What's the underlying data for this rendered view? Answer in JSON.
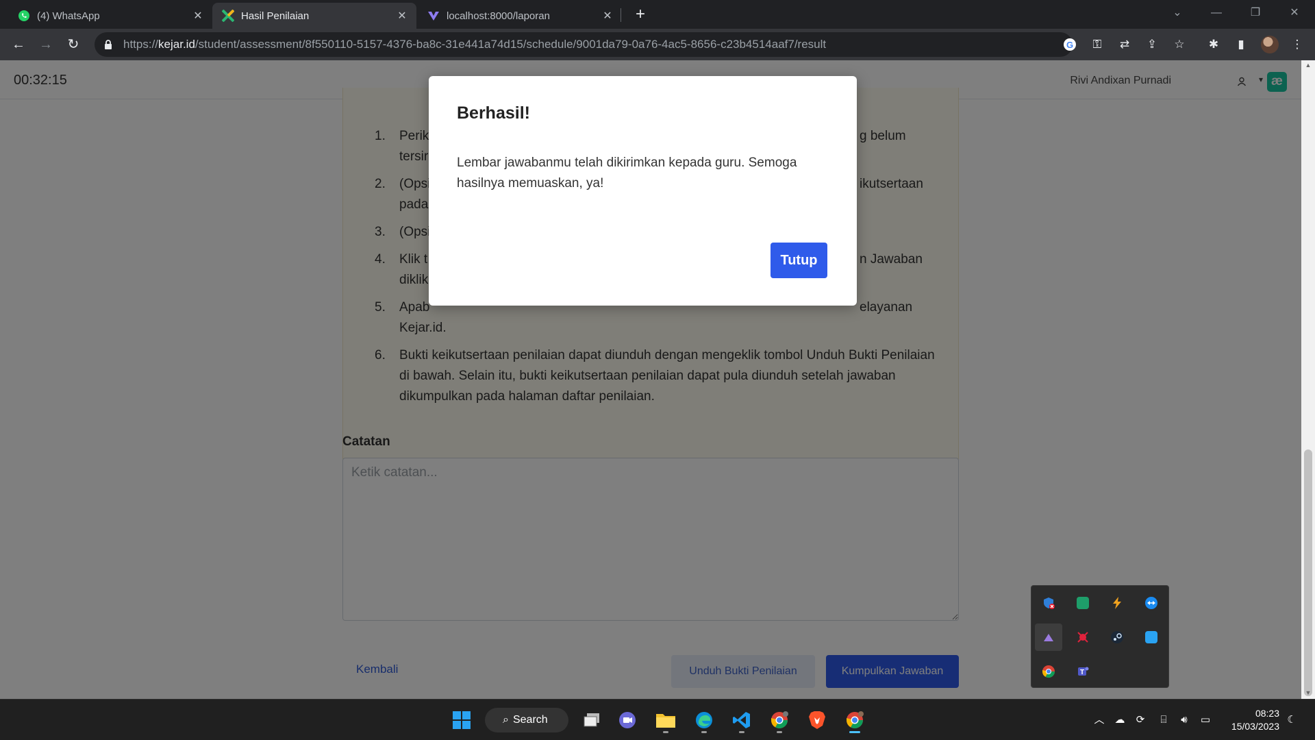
{
  "browser": {
    "tabs": [
      {
        "title": "(4) WhatsApp",
        "icon": "whatsapp-icon",
        "active": false
      },
      {
        "title": "Hasil Penilaian",
        "icon": "kejar-icon",
        "active": true
      },
      {
        "title": "localhost:8000/laporan",
        "icon": "vite-icon",
        "active": false
      }
    ],
    "url_prefix": "https://",
    "url_host": "kejar.id",
    "url_path": "/student/assessment/8f550110-5157-4376-ba8c-31e441a74d15/schedule/9001da79-0a76-4ac5-8656-c23b4514aaf7/result"
  },
  "header": {
    "timer": "00:32:15",
    "username": "Rivi Andixan Purnadi",
    "logo_text": "æ"
  },
  "instructions": [
    {
      "num": "1.",
      "text_left": "Perik",
      "text_right": "g belum",
      "line2_left": "tersir"
    },
    {
      "num": "2.",
      "text_left": "(Opsi",
      "text_right": "ikutsertaan",
      "line2_left": "pada"
    },
    {
      "num": "3.",
      "text_left": "(Opsi"
    },
    {
      "num": "4.",
      "text_left": "Klik t",
      "text_right": "n Jawaban",
      "line2_left": "diklik"
    },
    {
      "num": "5.",
      "text_left": "Apab",
      "text_right": "elayanan",
      "line2_left": "Kejar.id."
    },
    {
      "num": "6.",
      "text": "Bukti keikutsertaan penilaian dapat diunduh dengan mengeklik tombol Unduh Bukti Penilaian di bawah. Selain itu, bukti keikutsertaan penilaian dapat pula diunduh setelah jawaban dikumpulkan pada halaman daftar penilaian."
    }
  ],
  "notes": {
    "label": "Catatan",
    "placeholder": "Ketik catatan..."
  },
  "actions": {
    "back": "Kembali",
    "download": "Unduh Bukti Penilaian",
    "submit": "Kumpulkan Jawaban"
  },
  "modal": {
    "title": "Berhasil!",
    "body": "Lembar jawabanmu telah dikirimkan kepada guru. Semoga hasilnya memuaskan, ya!",
    "close_label": "Tutup"
  },
  "taskbar": {
    "search_label": "Search",
    "time": "08:23",
    "date": "15/03/2023"
  },
  "colors": {
    "primary": "#2f5bea",
    "brand": "#19c4a0",
    "instruction_bg": "#fffdf1"
  }
}
